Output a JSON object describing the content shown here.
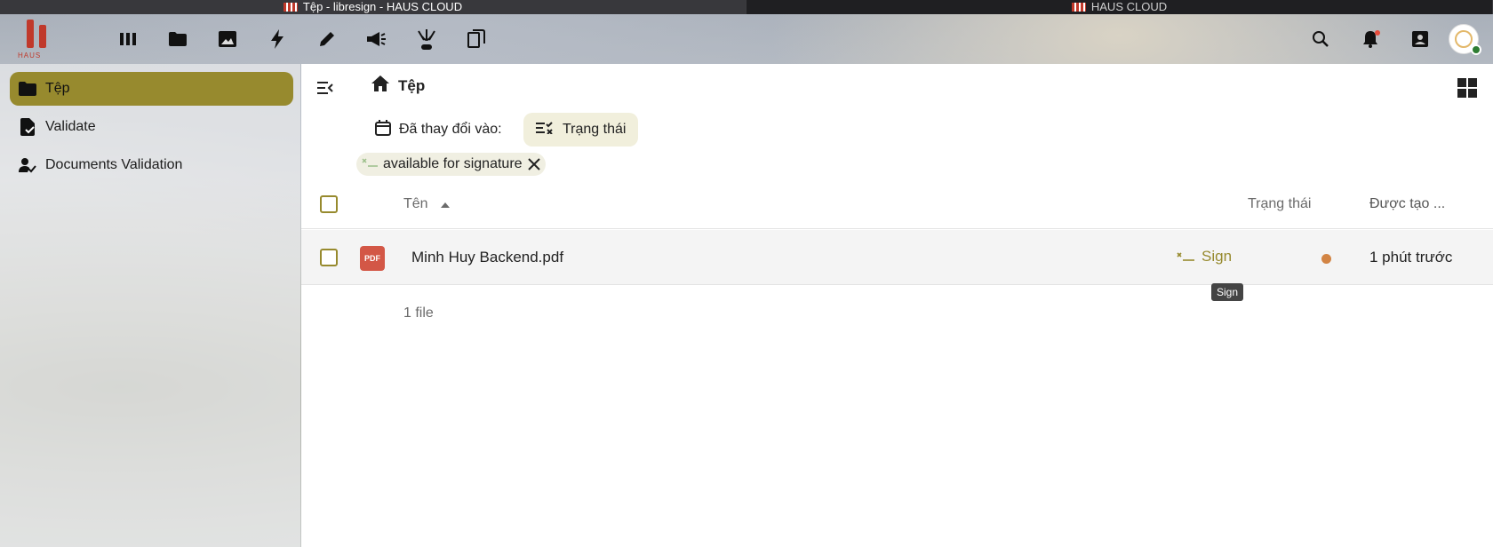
{
  "browser": {
    "tabs": [
      {
        "title": "Tệp - libresign - HAUS CLOUD"
      },
      {
        "title": "HAUS CLOUD"
      }
    ]
  },
  "header": {
    "logo_text": "HAUS",
    "apps": [
      {
        "icon": "dashboard-icon"
      },
      {
        "icon": "folder-icon"
      },
      {
        "icon": "image-icon"
      },
      {
        "icon": "activity-icon"
      },
      {
        "icon": "pencil-icon"
      },
      {
        "icon": "megaphone-icon"
      },
      {
        "icon": "libresign-icon"
      },
      {
        "icon": "copy-files-icon"
      }
    ],
    "right_icons": [
      "search-icon",
      "notification-bell-icon",
      "contacts-icon",
      "user-avatar"
    ]
  },
  "sidebar": {
    "items": [
      {
        "label": "Tệp",
        "icon": "folder-icon",
        "active": true
      },
      {
        "label": "Validate",
        "icon": "file-check-icon",
        "active": false
      },
      {
        "label": "Documents Validation",
        "icon": "account-check-icon",
        "active": false
      }
    ]
  },
  "main": {
    "breadcrumb": "Tệp",
    "filters": {
      "modified_label": "Đã thay đổi vào:",
      "status_label": "Trạng thái"
    },
    "active_chip": "available for signature",
    "table": {
      "columns": {
        "name": "Tên",
        "status": "Trạng thái",
        "created": "Được tạo ..."
      },
      "rows": [
        {
          "file_type": "PDF",
          "name": "Minh Huy Backend.pdf",
          "action": "Sign",
          "status_color": "#d28444",
          "created": "1 phút trước"
        }
      ],
      "summary": "1 file"
    },
    "tooltip": "Sign"
  },
  "colors": {
    "accent": "#978a2e",
    "pdf": "#d35746",
    "status_dot": "#d28444"
  }
}
